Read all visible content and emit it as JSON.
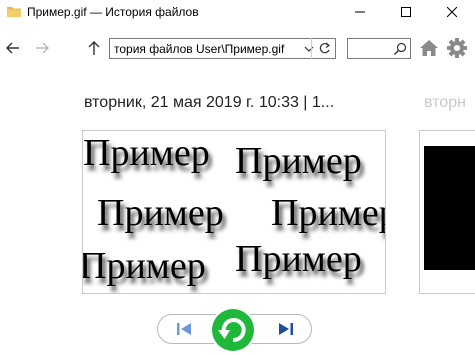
{
  "window": {
    "title": "Пример.gif — История файлов"
  },
  "nav": {
    "address": "тория файлов User\\Пример.gif",
    "search_placeholder": ""
  },
  "main": {
    "timestamp": "вторник, 21 мая 2019 г. 10:33   |   1...",
    "next_peek": "вторн",
    "preview_word": "Пример"
  },
  "colors": {
    "restore_green": "#1fb83a",
    "folder_yellow": "#e8b84a",
    "nav_blue": "#2a6fba"
  },
  "icons": [
    "folder-icon",
    "minimize-icon",
    "maximize-icon",
    "close-icon",
    "back-arrow-icon",
    "forward-arrow-icon",
    "up-arrow-icon",
    "chevron-down-icon",
    "refresh-icon",
    "search-icon",
    "home-icon",
    "gear-icon",
    "previous-version-icon",
    "restore-icon",
    "next-version-icon"
  ]
}
